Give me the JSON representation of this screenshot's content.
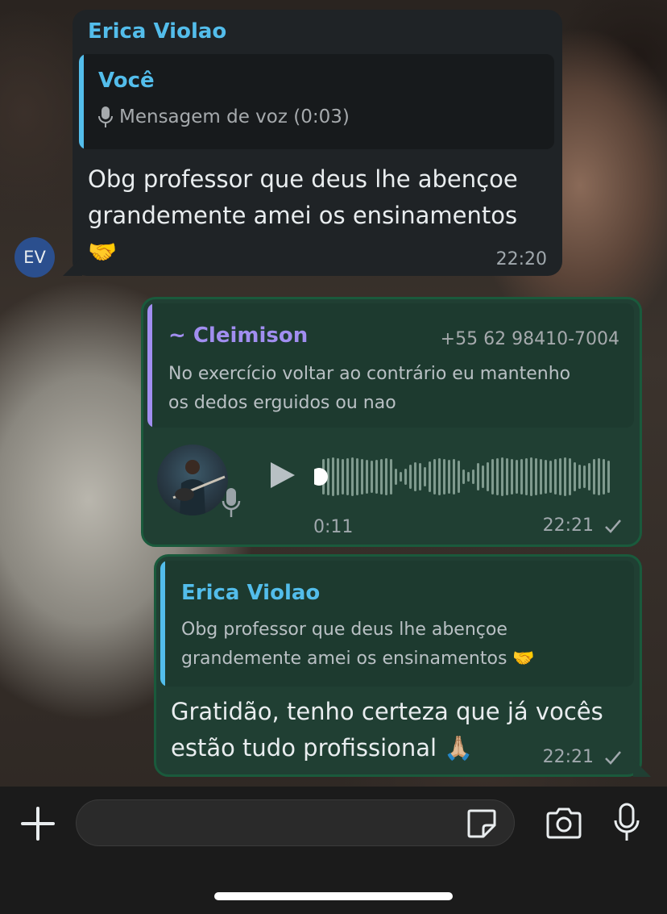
{
  "colors": {
    "incoming_bubble": "#1f2326",
    "outgoing_bubble": "#203f33",
    "accent_blue": "#53bdeb",
    "accent_purple": "#a18ef0"
  },
  "messages": {
    "incoming": {
      "sender": "Erica Violao",
      "reply_to": {
        "author": "Você",
        "icon": "mic-icon",
        "text": "Mensagem de voz (0:03)"
      },
      "text_line1": "Obg professor que deus lhe abençoe",
      "text_line2": "grandemente amei os ensinamentos",
      "emoji": "🤝",
      "time": "22:20",
      "avatar_initials": "EV"
    },
    "voice_reply": {
      "reply_to": {
        "author": "~ Cleimison",
        "phone": "+55 62 98410-7004",
        "text_line1": "No exercício voltar ao contrário eu mantenho",
        "text_line2": "os dedos erguidos  ou nao"
      },
      "voice": {
        "duration": "0:11",
        "progress": 0
      },
      "time": "22:21",
      "status": "sent"
    },
    "text_reply": {
      "reply_to": {
        "author": "Erica Violao",
        "text_line1": "Obg professor que deus lhe abençoe",
        "text_line2": "grandemente amei os ensinamentos 🤝"
      },
      "text_line1": "Gratidão, tenho certeza que já vocês",
      "text_line2": "estão tudo profissional 🙏🏼",
      "time": "22:21",
      "status": "sent"
    }
  },
  "composer": {
    "input_value": "",
    "plus_icon": "plus-icon",
    "sticker_icon": "sticker-icon",
    "camera_icon": "camera-icon",
    "mic_icon": "mic-icon"
  }
}
